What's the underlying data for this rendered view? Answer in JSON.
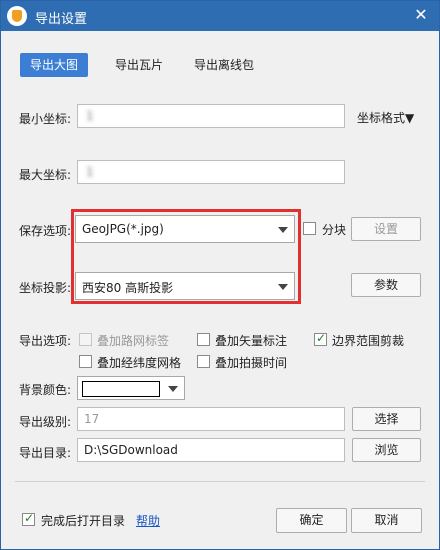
{
  "window": {
    "title": "导出设置",
    "close": "✕"
  },
  "tabs": [
    "导出大图",
    "导出瓦片",
    "导出离线包"
  ],
  "min_coord": {
    "label": "最小坐标:",
    "value": "1                         "
  },
  "max_coord": {
    "label": "最大坐标:",
    "value": "1                         "
  },
  "coord_format": {
    "label": "坐标格式▼"
  },
  "save_options": {
    "label": "保存选项:",
    "value": "GeoJPG(*.jpg)",
    "tile_label": "分块",
    "settings_button": "设置"
  },
  "projection": {
    "label": "坐标投影:",
    "value": "西安80 高斯投影",
    "params_button": "参数"
  },
  "export_options": {
    "label": "导出选项:",
    "items": [
      {
        "label": "叠加路网标签",
        "checked": false,
        "disabled": true
      },
      {
        "label": "叠加矢量标注",
        "checked": false,
        "disabled": false
      },
      {
        "label": "边界范围剪裁",
        "checked": true,
        "disabled": false
      },
      {
        "label": "叠加经纬度网格",
        "checked": false,
        "disabled": false
      },
      {
        "label": "叠加拍摄时间",
        "checked": false,
        "disabled": false
      }
    ]
  },
  "background_color": {
    "label": "背景颜色:",
    "color": "#ffffff"
  },
  "export_level": {
    "label": "导出级别:",
    "value": "17",
    "button": "选择"
  },
  "export_dir": {
    "label": "导出目录:",
    "value": "D:\\SGDownload",
    "button": "浏览"
  },
  "footer": {
    "open_after": "完成后打开目录",
    "open_after_checked": true,
    "help": "帮助",
    "ok": "确定",
    "cancel": "取消"
  }
}
